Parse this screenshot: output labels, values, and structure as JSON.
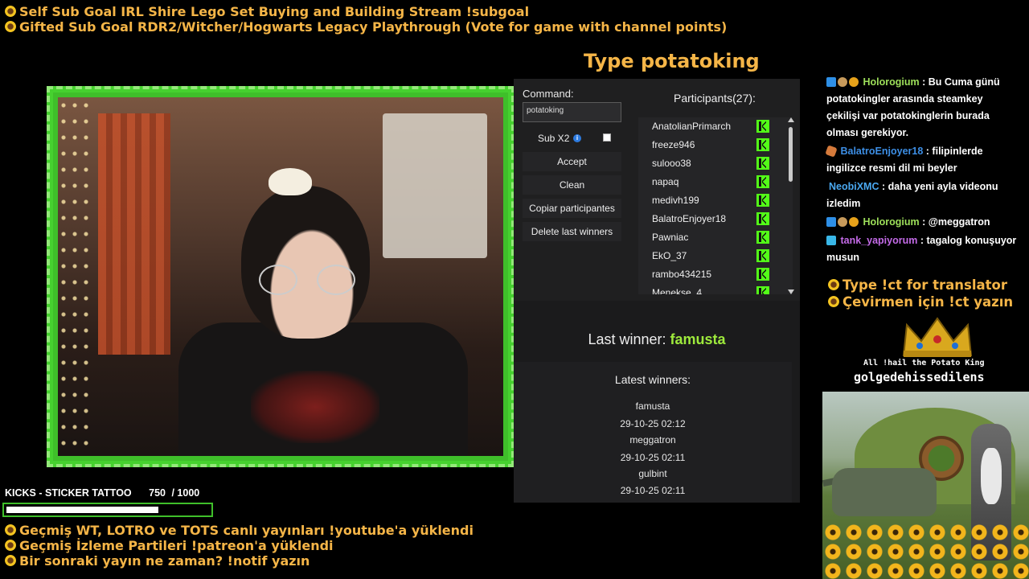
{
  "goals": [
    "Self Sub Goal IRL Shire Lego Set Buying and Building Stream !subgoal",
    "Gifted Sub Goal RDR2/Witcher/Hogwarts Legacy Playthrough (Vote for game with channel points)"
  ],
  "type_command": "Type potatoking",
  "panel": {
    "command_label": "Command:",
    "command_value": "potatoking",
    "sub_label": "Sub X2",
    "info_icon": "i",
    "buttons": [
      "Accept",
      "Clean",
      "Copiar participantes",
      "Delete last winners"
    ],
    "participants_title": "Participants(27):",
    "participants": [
      "AnatolianPrimarch",
      "freeze946",
      "sulooo38",
      "napaq",
      "medivh199",
      "BalatroEnjoyer18",
      "Pawniac",
      "EkO_37",
      "rambo434215",
      "Menekse_4"
    ],
    "last_winner_label": "Last winner:",
    "last_winner": "famusta",
    "latest_title": "Latest winners:",
    "latest_winners": [
      {
        "name": "famusta",
        "time": "29-10-25 02:12"
      },
      {
        "name": "meggatron",
        "time": "29-10-25 02:11"
      },
      {
        "name": "gulbint",
        "time": "29-10-25 02:11"
      }
    ]
  },
  "chat": [
    {
      "badges": [
        "blue",
        "potato",
        "gold"
      ],
      "user": "Holorogium",
      "color": "#9ee05a",
      "lines": [
        ": Bu Cuma günü",
        "potatokingler arasında steamkey",
        "çekilişi var potatokinglerin burada",
        "olması gerekiyor."
      ]
    },
    {
      "badges": [
        "brush"
      ],
      "user": "BalatroEnjoyer18",
      "color": "#3d8fe6",
      "lines": [
        ": filipinlerde",
        "ingilizce resmi dil mi beyler"
      ]
    },
    {
      "badges": [],
      "user": "NeobiXMC",
      "color": "#4aa8f0",
      "lines": [
        ": daha yeni ayla videonu",
        "izledim"
      ]
    },
    {
      "badges": [
        "blue",
        "potato",
        "gold"
      ],
      "user": "Holorogium",
      "color": "#9ee05a",
      "lines": [
        ": @meggatron"
      ]
    },
    {
      "badges": [
        "cube"
      ],
      "user": "tank_yapiyorum",
      "color": "#c46be8",
      "lines": [
        ": tagalog konuşuyor",
        "musun"
      ]
    }
  ],
  "translator": [
    "Type !ct for translator",
    "Çevirmen için !ct yazın"
  ],
  "potato_king": {
    "hail": "All !hail the Potato King",
    "name": "golgedehissedilens"
  },
  "kicks": {
    "label": "KICKS - STICKER TATTOO",
    "current": "750",
    "goal": "/ 1000",
    "progress": 0.75
  },
  "tickers": [
    "Geçmiş WT, LOTRO ve TOTS canlı yayınları !youtube'a yüklendi",
    "Geçmiş İzleme Partileri !patreon'a yüklendi",
    "Bir sonraki yayın ne zaman? !notif yazın"
  ],
  "colors": {
    "accent": "#f5b547",
    "kick_green": "#53fc18",
    "winner_green": "#9eea3c",
    "frame_green": "#46d12f"
  }
}
